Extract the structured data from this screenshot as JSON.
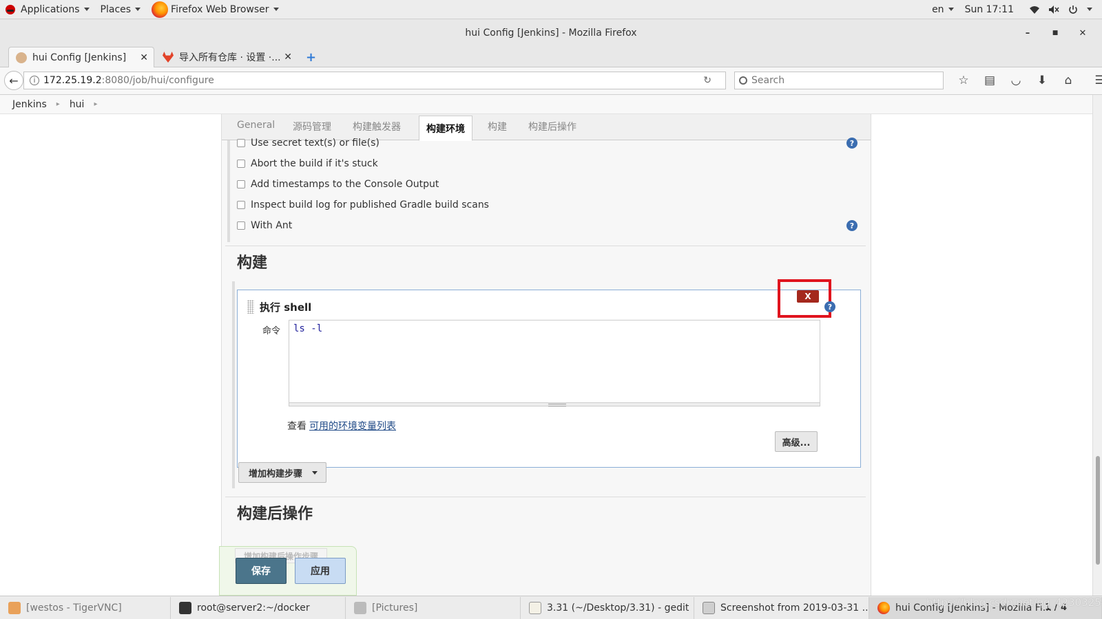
{
  "gnome_bar": {
    "applications": "Applications",
    "places": "Places",
    "active_app": "Firefox Web Browser",
    "language": "en",
    "clock": "Sun 17:11"
  },
  "window": {
    "title": "hui Config [Jenkins] - Mozilla Firefox",
    "minimize": "–",
    "maximize": "■",
    "close": "✕"
  },
  "tabs": [
    {
      "label": "hui Config [Jenkins]",
      "close": "✕"
    },
    {
      "label": "导入所有仓库 · 设置 ·...",
      "close": "✕"
    }
  ],
  "new_tab": "+",
  "navbar": {
    "url_host": "172.25.19.2",
    "url_path": ":8080/job/hui/configure",
    "search_placeholder": "Search"
  },
  "breadcrumb": [
    "Jenkins",
    "hui"
  ],
  "config_tabs": [
    "General",
    "源码管理",
    "构建触发器",
    "构建环境",
    "构建",
    "构建后操作"
  ],
  "build_env_options": [
    "Use secret text(s) or file(s)",
    "Abort the build if it's stuck",
    "Add timestamps to the Console Output",
    "Inspect build log for published Gradle build scans",
    "With Ant"
  ],
  "build_section": {
    "title": "构建",
    "step_title": "执行 shell",
    "delete_label": "X",
    "command_label": "命令",
    "command_value": "ls -l",
    "env_prefix": "查看",
    "env_link": "可用的环境变量列表",
    "advanced_button": "高级...",
    "add_step_button": "增加构建步骤"
  },
  "post_build": {
    "title": "构建后操作",
    "add_step_button": "增加构建后操作步骤",
    "save_button": "保存",
    "apply_button": "应用"
  },
  "taskbar": [
    {
      "label": "[westos - TigerVNC]"
    },
    {
      "label": "root@server2:~/docker"
    },
    {
      "label": "[Pictures]"
    },
    {
      "label": "3.31 (~/Desktop/3.31) - gedit"
    },
    {
      "label": "Screenshot from 2019-03-31 ..."
    },
    {
      "label": "hui Config [Jenkins] - Mozilla Fi..."
    }
  ],
  "page_counter": "1 / 4",
  "watermark": "https://blog.csdn.net/qq_42303254",
  "colors": {
    "delete_red": "#a4281d",
    "highlight_red": "#e0141e",
    "save_blue": "#4b758b",
    "apply_blue": "#c8dcf3",
    "link": "#204a87"
  }
}
